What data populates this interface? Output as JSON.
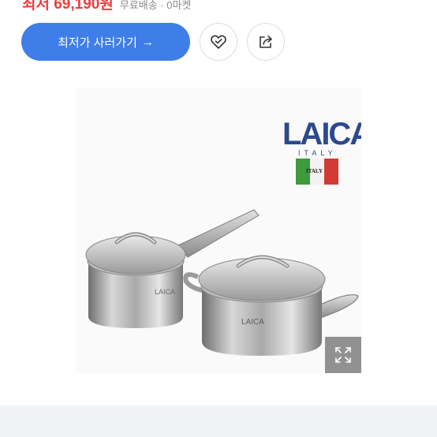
{
  "price": {
    "lowest_label": "최저 69,190원",
    "shipping_info": "무료배송 · 0마켓"
  },
  "actions": {
    "lowest_button_label": "최저가 사러가기",
    "lowest_button_arrow": "→"
  },
  "product": {
    "brand_logo": "LAICA",
    "brand_country": "ITALY",
    "flag_text": "ITALY",
    "pot_engraving": "LAICA"
  },
  "colors": {
    "accent": "#3f7ee8",
    "price": "#ee3b3b",
    "logo_blue": "#2c4a8c"
  },
  "icons": {
    "wishlist": "heart-check-icon",
    "share": "share-icon",
    "expand": "expand-icon"
  }
}
